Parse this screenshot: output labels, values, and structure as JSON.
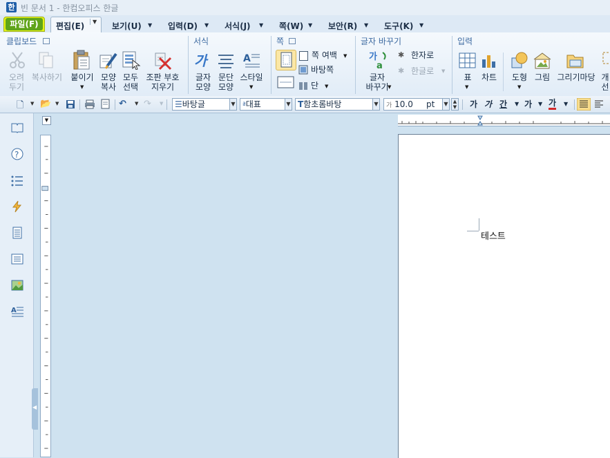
{
  "window": {
    "title": "빈 문서 1 - 한컴오피스 한글"
  },
  "menu": {
    "items": [
      {
        "label": "파일(F)"
      },
      {
        "label": "편집(E)"
      },
      {
        "label": "보기(U)"
      },
      {
        "label": "입력(D)"
      },
      {
        "label": "서식(J)"
      },
      {
        "label": "쪽(W)"
      },
      {
        "label": "보안(R)"
      },
      {
        "label": "도구(K)"
      }
    ]
  },
  "ribbon": {
    "groups": {
      "clipboard": "클립보드",
      "format": "서식",
      "page": "쪽",
      "convert": "글자 바꾸기",
      "insert": "입력"
    },
    "buttons": {
      "cut": [
        "오려",
        "두기"
      ],
      "copy": "복사하기",
      "paste": "붙이기",
      "shape_copy": [
        "모양",
        "복사"
      ],
      "select_all": [
        "모두",
        "선택"
      ],
      "erase_marks": [
        "조판 부호",
        "지우기"
      ],
      "char_shape": [
        "글자",
        "모양"
      ],
      "para_shape": [
        "문단",
        "모양"
      ],
      "style": "스타일",
      "page_margin": "쪽 여백",
      "master_page": "바탕쪽",
      "column": "단",
      "convert_chars": [
        "글자",
        "바꾸기"
      ],
      "to_hanja": "한자로",
      "to_hangul": "한글로",
      "table": "표",
      "chart": "차트",
      "shape": "도형",
      "picture": "그림",
      "gallery": "그리기마당",
      "object": [
        "개",
        "선"
      ]
    }
  },
  "toolbar": {
    "style": "바탕글",
    "lang": "대표",
    "font": "함초롬바탕",
    "font_prefix": "T",
    "size": "10.0",
    "size_unit": "pt",
    "size_prefix": "가",
    "bold": "가",
    "italic": "가",
    "underline": "간",
    "strike": "가",
    "fontcolor": "가"
  },
  "document": {
    "text": "테스트"
  },
  "colors": {
    "file_tab_highlight": "#e8f416",
    "file_tab": "#5fa419",
    "group_label": "#3d6aa1",
    "workspace": "#cfe2f0"
  }
}
